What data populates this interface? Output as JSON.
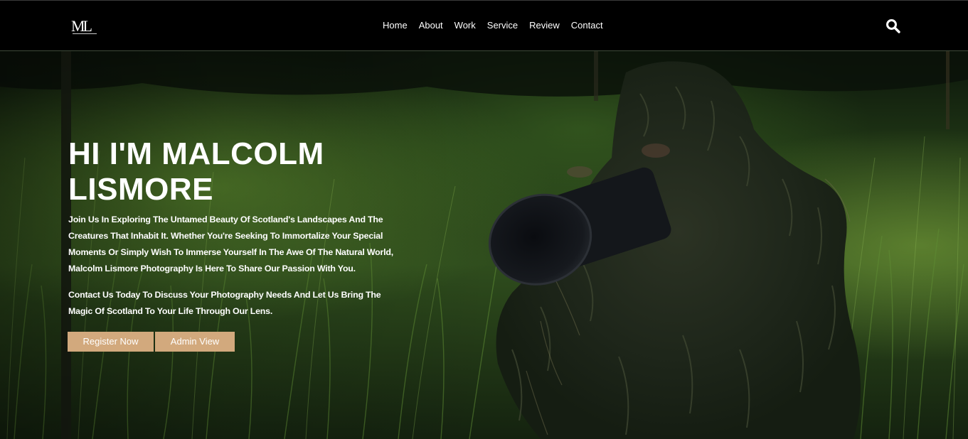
{
  "header": {
    "logo_text": "ML",
    "nav": [
      {
        "label": "Home"
      },
      {
        "label": "About"
      },
      {
        "label": "Work"
      },
      {
        "label": "Service"
      },
      {
        "label": "Review"
      },
      {
        "label": "Contact"
      }
    ],
    "search_icon": "search-icon"
  },
  "hero": {
    "title": "HI I'M MALCOLM LISMORE",
    "paragraph_1": "Join Us In Exploring The Untamed Beauty Of Scotland's Landscapes And The Creatures That Inhabit It. Whether You're Seeking To Immortalize Your Special Moments Or Simply Wish To Immerse Yourself In The Awe Of The Natural World, Malcolm Lismore Photography Is Here To Share Our Passion With You.",
    "paragraph_2": "Contact Us Today To Discuss Your Photography Needs And Let Us Bring The Magic Of Scotland To Your Life Through Our Lens.",
    "register_label": "Register Now",
    "admin_label": "Admin View"
  },
  "colors": {
    "header_bg": "#000000",
    "button_bg": "#d2a97d",
    "text": "#ffffff",
    "grass_dark": "#0f1c0d",
    "grass_light": "#4f7a2c"
  }
}
